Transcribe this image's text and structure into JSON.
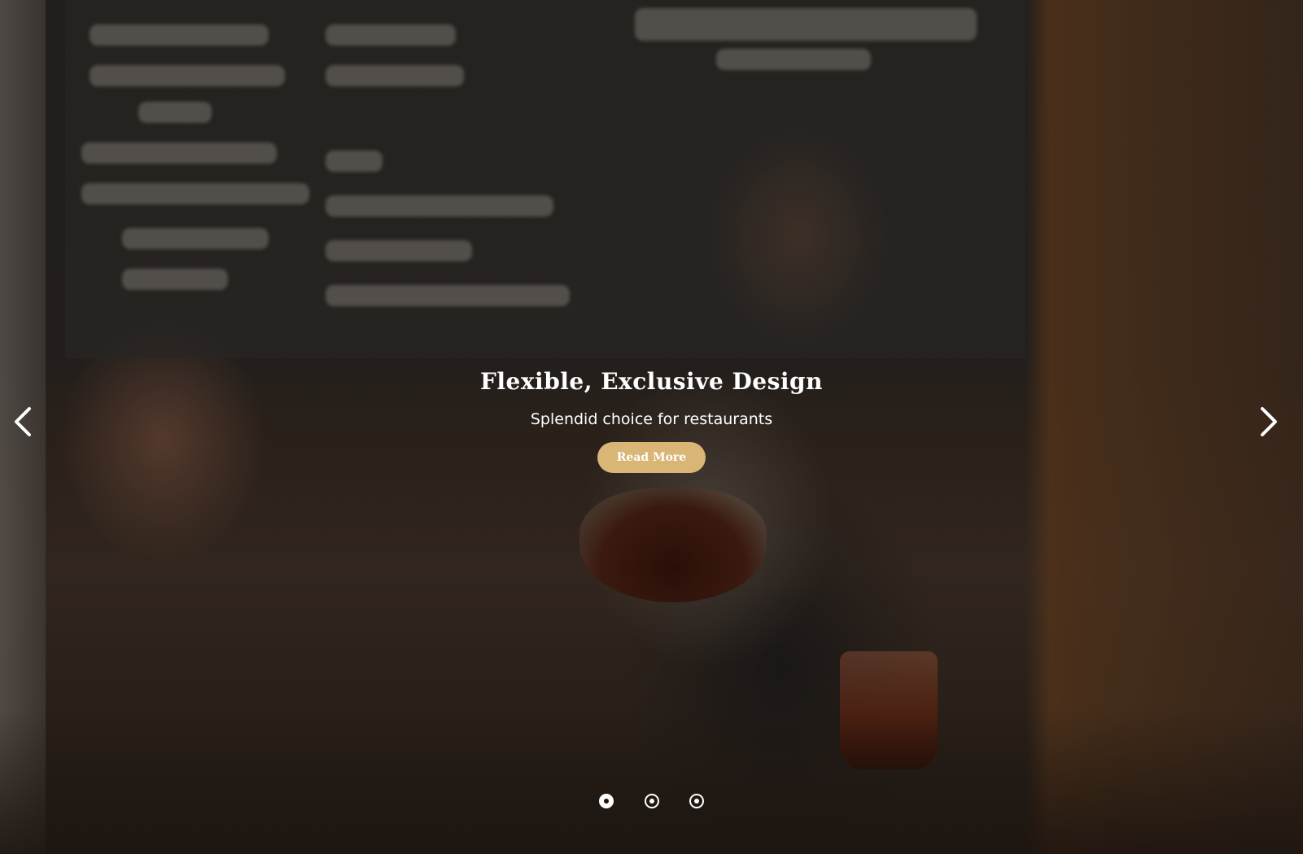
{
  "slider": {
    "slides": [
      {
        "title": "Flexible, Exclusive Design",
        "subtitle": "Splendid choice for restaurants",
        "button_label": "Read More"
      }
    ],
    "active_index": 0,
    "dot_count": 3,
    "prev_icon": "chevron-left-icon",
    "next_icon": "chevron-right-icon"
  },
  "colors": {
    "button_bg": "#d9b676",
    "caption_text": "#ffffff",
    "overlay": "#140e0a"
  }
}
